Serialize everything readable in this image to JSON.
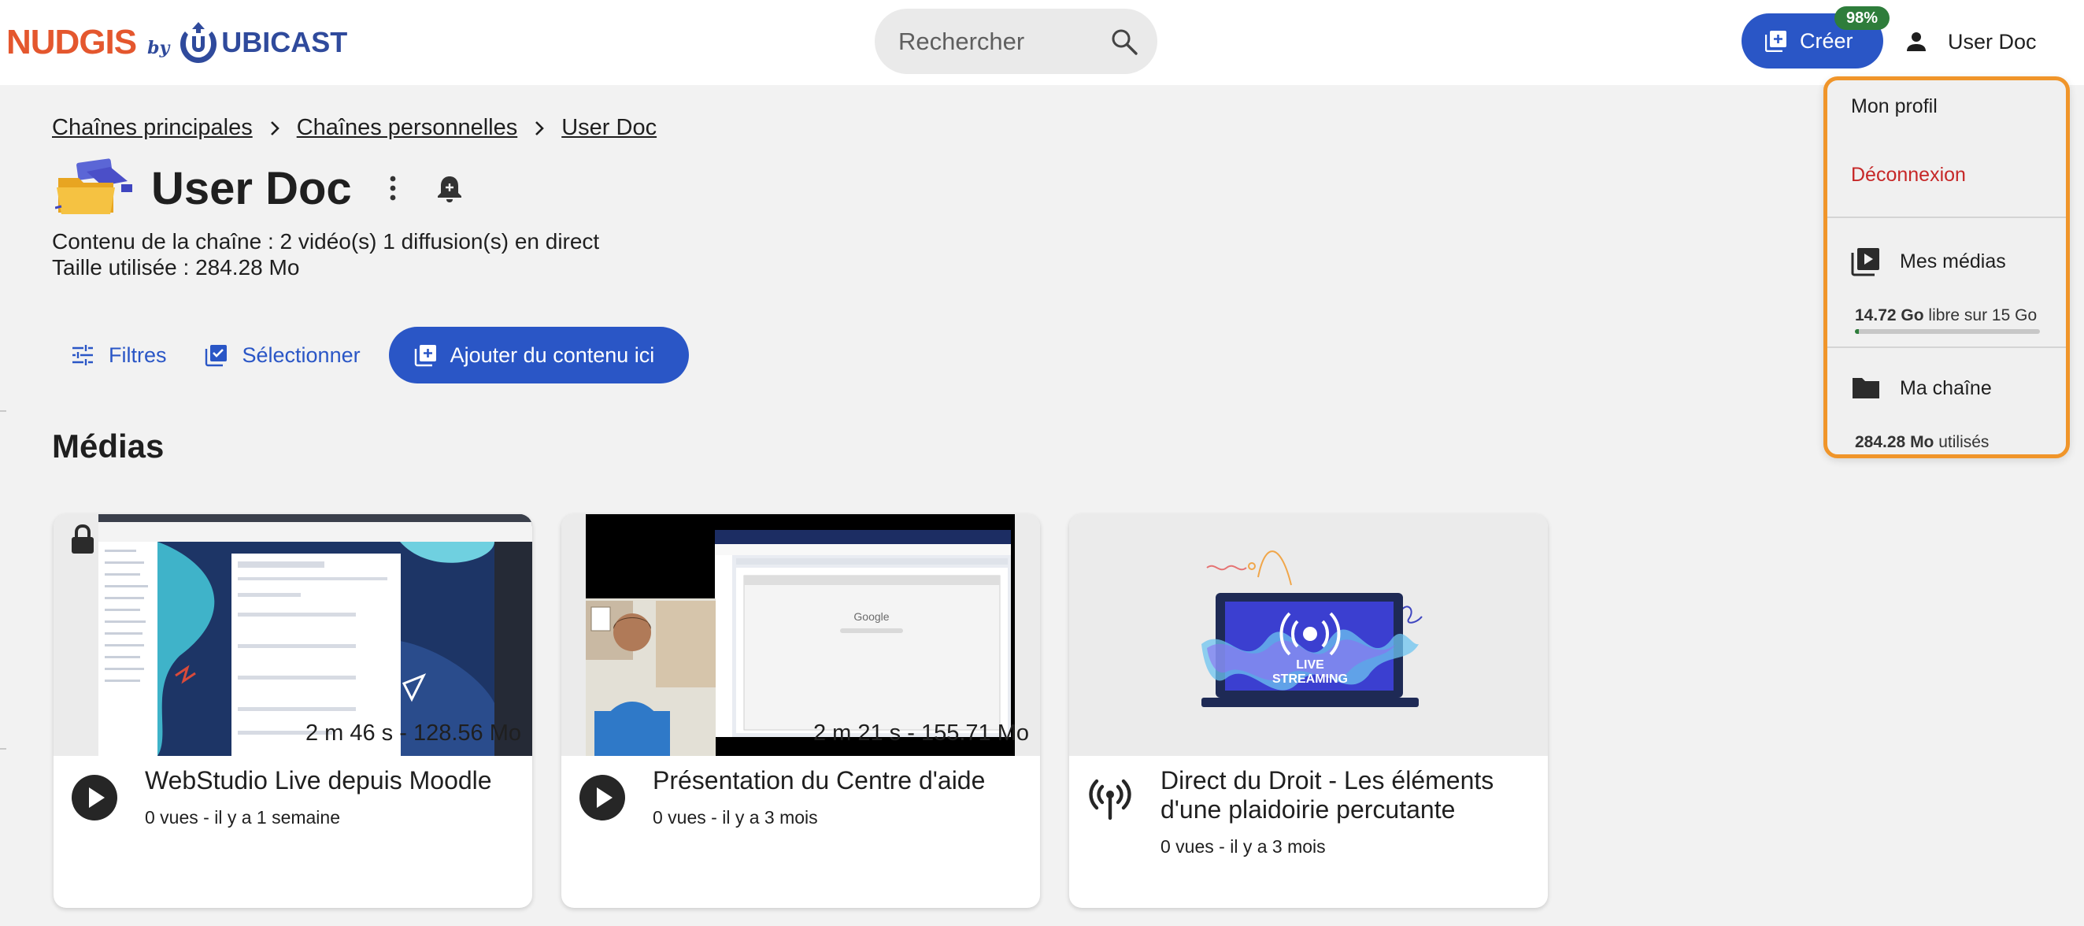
{
  "header": {
    "logo": {
      "brand": "NUDGIS",
      "by": "by",
      "company": "UBICAST"
    },
    "search": {
      "placeholder": "Rechercher"
    },
    "create": {
      "label": "Créer",
      "quota_badge": "98%"
    },
    "user": {
      "name": "User Doc"
    }
  },
  "breadcrumb": [
    "Chaînes principales",
    "Chaînes personnelles",
    "User Doc"
  ],
  "channel": {
    "title": "User Doc",
    "content_line": "Contenu de la chaîne : 2 vidéo(s) 1 diffusion(s) en direct",
    "size_line": "Taille utilisée : 284.28 Mo"
  },
  "actions": {
    "filters": "Filtres",
    "select": "Sélectionner",
    "add": "Ajouter du contenu ici"
  },
  "section_title": "Médias",
  "cards": [
    {
      "title": "WebStudio Live depuis Moodle",
      "meta": "0 vues  - il y a 1 semaine",
      "duration": "2 m 46 s - 128.56 Mo",
      "type": "video",
      "locked": true
    },
    {
      "title": "Présentation du Centre d'aide",
      "meta": "0 vues  - il y a 3 mois",
      "duration": "2 m 21 s - 155.71 Mo",
      "type": "video",
      "locked": false
    },
    {
      "title": "Direct du Droit - Les éléments d'une plaidoirie percutante",
      "meta": "0 vues  - il y a 3 mois",
      "type": "live",
      "locked": false,
      "thumb_text": "LIVE STREAMING"
    }
  ],
  "dropdown": {
    "profile": "Mon profil",
    "logout": "Déconnexion",
    "my_media": "Mes médias",
    "media_quota_value": "14.72 Go",
    "media_quota_text": " libre sur 15 Go",
    "media_used_fraction": 0.02,
    "my_channel": "Ma chaîne",
    "channel_used_value": "284.28 Mo",
    "channel_used_text": " utilisés"
  },
  "colors": {
    "accent": "#2a56c6",
    "logout": "#c62828",
    "highlight_border": "#f0952a",
    "badge": "#2e7d3b",
    "logo_orange": "#e4572e",
    "logo_blue": "#2f4a9c"
  }
}
